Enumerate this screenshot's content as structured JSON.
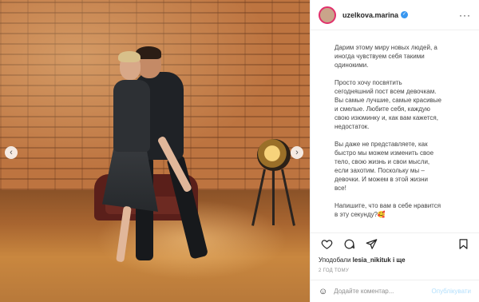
{
  "post": {
    "username": "uzelkova.marina",
    "verified_icon": "verified-badge-icon",
    "more_icon": "more-options-icon",
    "caption": [
      "Дарим этому миру новых людей, а\nиногда чувствуем себя такими\nодинокими.",
      "Просто хочу посвятить\nсегодняшний пост всем девочкам.\nВы самые лучшие, самые красивые\nи смелые. Любите себя, каждую\nсвою изюминку и, как вам кажется,\nнедостаток.",
      "Вы даже не представляете, как\nбыстро мы можем изменить свое\nтело, свою жизнь и свои мысли,\nесли захотим. Поскольку мы –\nдевочки. И можем в этой жизни\nвсе!",
      "Напишите, что вам в себе нравится\nв эту секунду?🥰"
    ],
    "likes_prefix": "Уподобали",
    "likes_user": "lesia_nikituk",
    "likes_suffix": "і ще",
    "time": "2 ГОД ТОМУ",
    "comment_placeholder": "Додайте коментар...",
    "publish_label": "Опублікувати"
  },
  "colors": {
    "accent": "#3897f0",
    "publish_disabled": "#b2dffc"
  },
  "icons": {
    "prev": "chevron-left-icon",
    "next": "chevron-right-icon",
    "like": "heart-icon",
    "comment": "comment-icon",
    "save": "bookmark-icon",
    "emoji": "smiley-icon"
  }
}
